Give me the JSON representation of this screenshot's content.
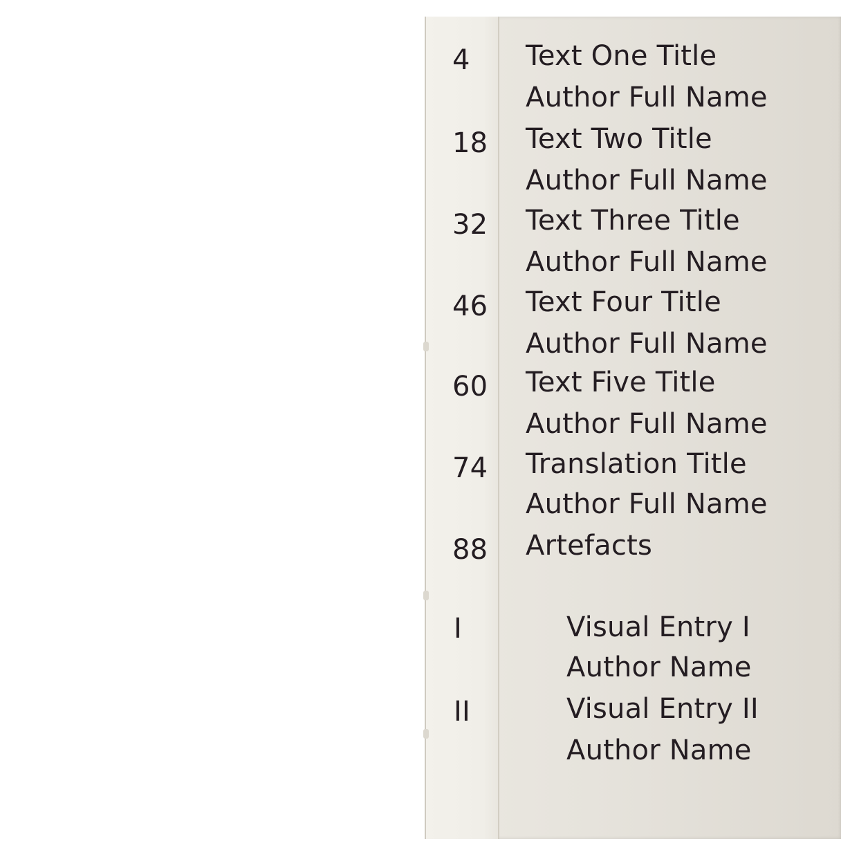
{
  "contents": {
    "entries": [
      {
        "page": "4",
        "title": "Text One Title",
        "author": "Author Full Name"
      },
      {
        "page": "18",
        "title": "Text Two Title",
        "author": "Author Full Name"
      },
      {
        "page": "32",
        "title": "Text Three Title",
        "author": "Author Full Name"
      },
      {
        "page": "46",
        "title": "Text Four Title",
        "author": "Author Full Name"
      },
      {
        "page": "60",
        "title": "Text Five Title",
        "author": "Author Full Name"
      },
      {
        "page": "74",
        "title": "Translation Title",
        "author": "Author Full Name"
      },
      {
        "page": "88",
        "title": "Artefacts"
      }
    ],
    "visual_entries": [
      {
        "page": "I",
        "title": "Visual Entry I",
        "author": "Author Name"
      },
      {
        "page": "II",
        "title": "Visual Entry II",
        "author": "Author Name"
      }
    ]
  },
  "colors": {
    "paper": "#e8e5de",
    "flap": "#f1efe9",
    "ink": "#241d22",
    "background": "#ffffff"
  }
}
